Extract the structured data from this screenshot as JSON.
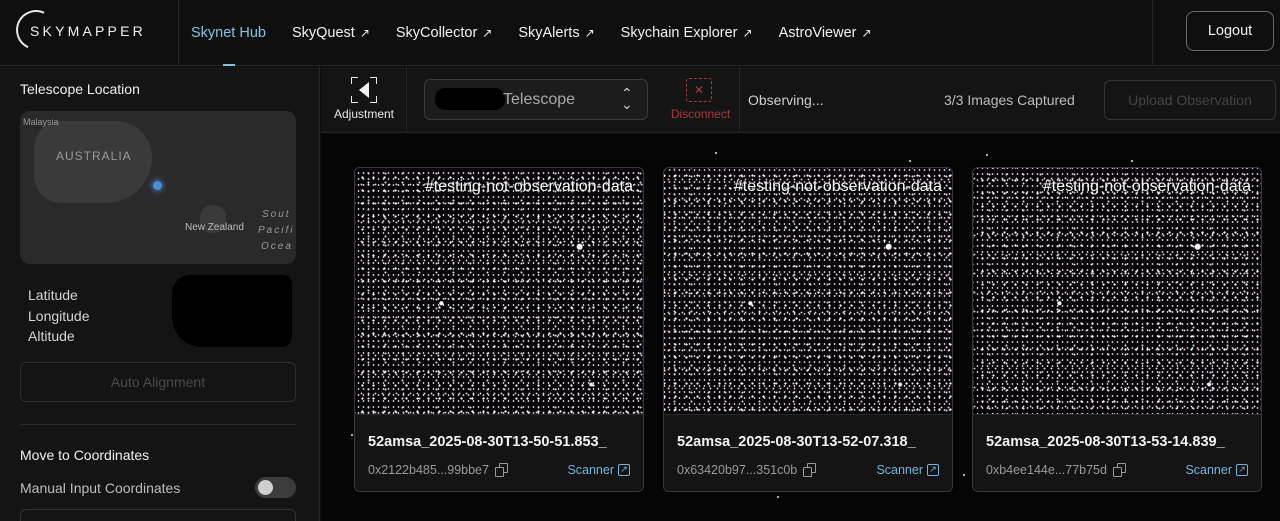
{
  "header": {
    "logo_text": "SKYMAPPER",
    "nav": [
      {
        "label": "Skynet Hub",
        "external": false,
        "active": true
      },
      {
        "label": "SkyQuest",
        "external": true
      },
      {
        "label": "SkyCollector",
        "external": true
      },
      {
        "label": "SkyAlerts",
        "external": true
      },
      {
        "label": "Skychain Explorer",
        "external": true
      },
      {
        "label": "AstroViewer",
        "external": true
      }
    ],
    "external_glyph": "↗",
    "logout_label": "Logout",
    "accent_color": "#7cc8e0"
  },
  "sidebar": {
    "location_title": "Telescope Location",
    "map": {
      "labels": {
        "malaysia": "Malaysia",
        "australia": "AUSTRALIA",
        "new_zealand": "New Zealand",
        "south": "Sout",
        "pacific": "Pacifi",
        "ocean": "Ocea"
      }
    },
    "coord_labels": {
      "latitude": "Latitude",
      "longitude": "Longitude",
      "altitude": "Altitude"
    },
    "auto_alignment_label": "Auto Alignment",
    "move_title": "Move to Coordinates",
    "manual_input_label": "Manual Input Coordinates",
    "manual_input_enabled": false
  },
  "controls": {
    "adjustment_label": "Adjustment",
    "telescope_value": "Telescope",
    "disconnect_label": "Disconnect",
    "status": "Observing...",
    "captured": "3/3 Images Captured",
    "upload_label": "Upload Observation",
    "danger_color": "#a93a3a"
  },
  "observations": [
    {
      "tag": "#testing-not-observation-data",
      "filename": "52amsa_2025-08-30T13-50-51.853_",
      "hash": "0x2122b485...99bbe7",
      "link": "Scanner"
    },
    {
      "tag": "#testing-not-observation-data",
      "filename": "52amsa_2025-08-30T13-52-07.318_",
      "hash": "0x63420b97...351c0b",
      "link": "Scanner"
    },
    {
      "tag": "#testing-not-observation-data",
      "filename": "52amsa_2025-08-30T13-53-14.839_",
      "hash": "0xb4ee144e...77b75d",
      "link": "Scanner"
    }
  ]
}
